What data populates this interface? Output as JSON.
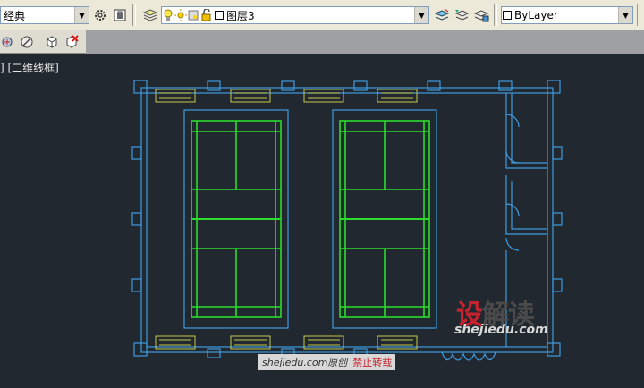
{
  "toolbar_top": {
    "workspace_value": "经典",
    "layer_value": "图层3",
    "color_value": "ByLayer"
  },
  "viewport": {
    "label": "] [二维线框]"
  },
  "watermark": {
    "logo_part1": "设",
    "logo_part2": "解读",
    "site": "shejiedu.com",
    "notice_site": "shejiedu.com原创",
    "notice_ban": "禁止转载"
  },
  "colors": {
    "model_background": "#212830",
    "wall_blue": "#3f9be0",
    "court_green": "#2bdc2b",
    "bench_yellow": "#c8c84a"
  },
  "icons": {
    "workspace_settings": "gear-icon",
    "workspace_switch": "toolbar-lock-icon",
    "layer_manager": "layer-properties-icon",
    "layer_on": "bulb-icon",
    "layer_freeze": "sun-icon",
    "layer_lock": "padlock-open-icon",
    "layer_current": "make-current-icon",
    "layer_previous": "layer-previous-icon",
    "layer_state": "layer-state-icon"
  }
}
